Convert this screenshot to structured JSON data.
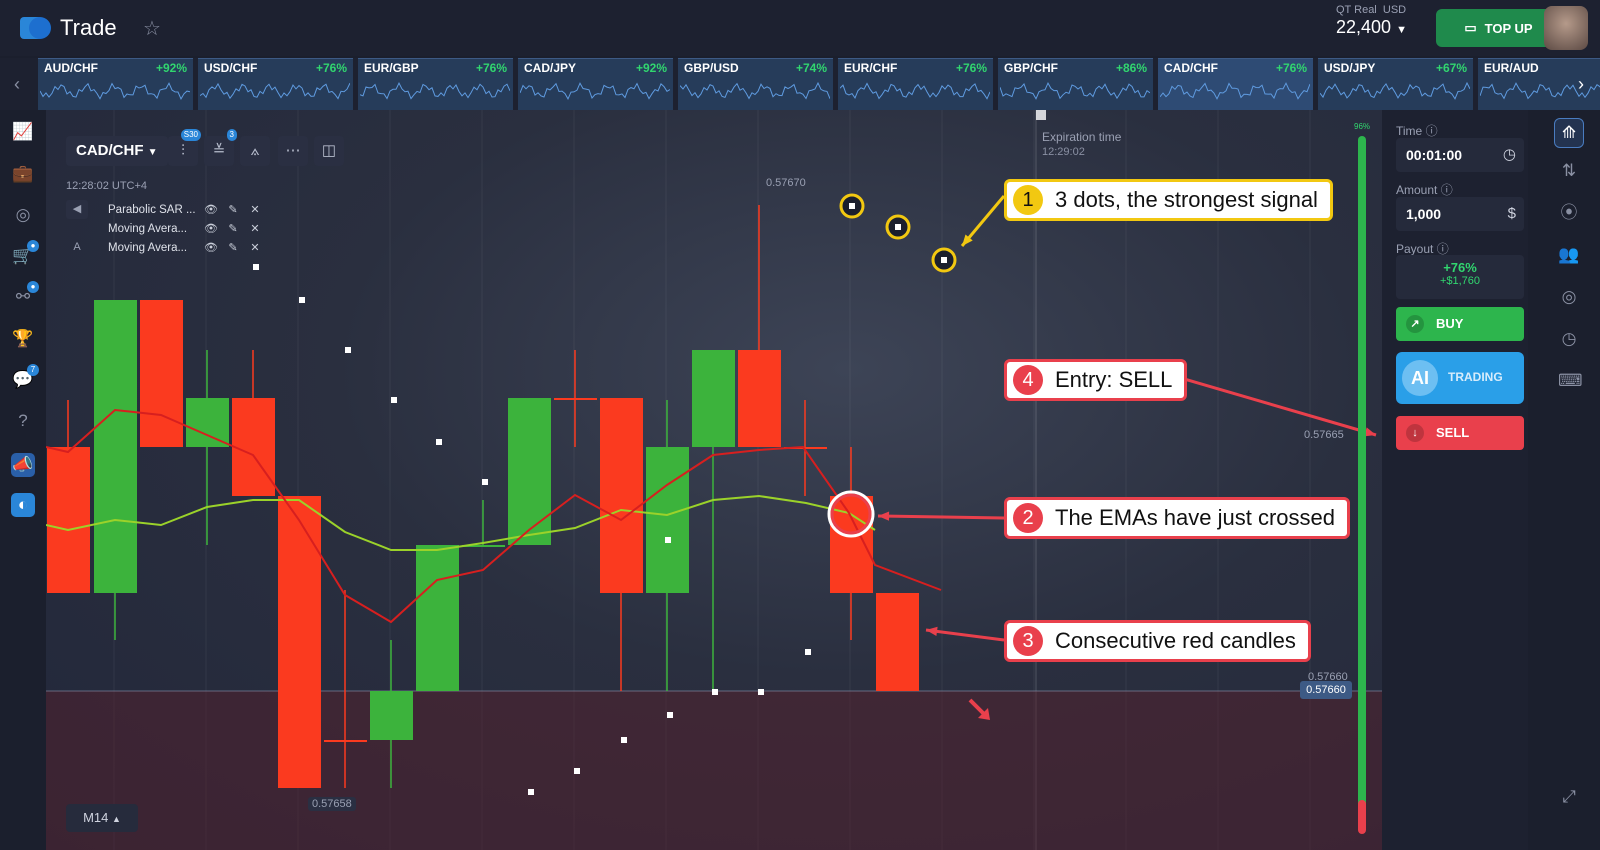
{
  "header": {
    "logo_text": "Trade",
    "account_type": "QT Real",
    "account_currency": "USD",
    "balance": "22,400",
    "topup_label": "TOP UP"
  },
  "pairs": [
    {
      "name": "AUD/CHF",
      "pct": "+92%"
    },
    {
      "name": "USD/CHF",
      "pct": "+76%"
    },
    {
      "name": "EUR/GBP",
      "pct": "+76%"
    },
    {
      "name": "CAD/JPY",
      "pct": "+92%"
    },
    {
      "name": "GBP/USD",
      "pct": "+74%"
    },
    {
      "name": "EUR/CHF",
      "pct": "+76%"
    },
    {
      "name": "GBP/CHF",
      "pct": "+86%"
    },
    {
      "name": "CAD/CHF",
      "pct": "+76%"
    },
    {
      "name": "USD/JPY",
      "pct": "+67%"
    },
    {
      "name": "EUR/AUD",
      "pct": ""
    }
  ],
  "left_sidebar": [
    {
      "icon": "chart-icon"
    },
    {
      "icon": "briefcase-icon"
    },
    {
      "icon": "user-icon"
    },
    {
      "icon": "cart-icon",
      "badge": ""
    },
    {
      "icon": "network-icon",
      "badge": ""
    },
    {
      "icon": "trophy-icon"
    },
    {
      "icon": "chat-icon",
      "badge": "7"
    },
    {
      "icon": "help-icon"
    },
    {
      "icon": "megaphone-icon"
    },
    {
      "icon": "app-icon"
    }
  ],
  "chart": {
    "pair": "CAD/CHF",
    "candle_badge": "S30",
    "indicator_badge": "3",
    "clock": "12:28:02 UTC+4",
    "indicators": [
      "Parabolic SAR ...",
      "Moving Avera...",
      "Moving Avera..."
    ],
    "expiration_label": "Expiration time",
    "expiration_time": "12:29:02",
    "price_top": "0.57670",
    "price_mid": "0.57665",
    "price_low": "0.57660",
    "price_current": "0.57660",
    "price_bottom": "0.57658",
    "timeframe": "M14"
  },
  "callouts": [
    {
      "num": "1",
      "text": "3 dots, the strongest signal"
    },
    {
      "num": "4",
      "text": "Entry: SELL"
    },
    {
      "num": "2",
      "text": "The EMAs have just crossed"
    },
    {
      "num": "3",
      "text": "Consecutive red candles"
    }
  ],
  "panel": {
    "time_label": "Time",
    "time_value": "00:01:00",
    "amount_label": "Amount",
    "amount_value": "1,000",
    "payout_label": "Payout",
    "payout_pct": "+76%",
    "payout_amount": "+$1,760",
    "buy_label": "BUY",
    "ai_label": "AI",
    "ai_trading": "TRADING",
    "sell_label": "SELL",
    "sentiment": "96%"
  },
  "colors": {
    "bull": "#3cb33c",
    "bear": "#fb3a1f",
    "ema_fast": "#d71f1f",
    "ema_slow": "#9bd22a",
    "accent_yellow": "#f2c811",
    "accent_red": "#e9404c"
  }
}
